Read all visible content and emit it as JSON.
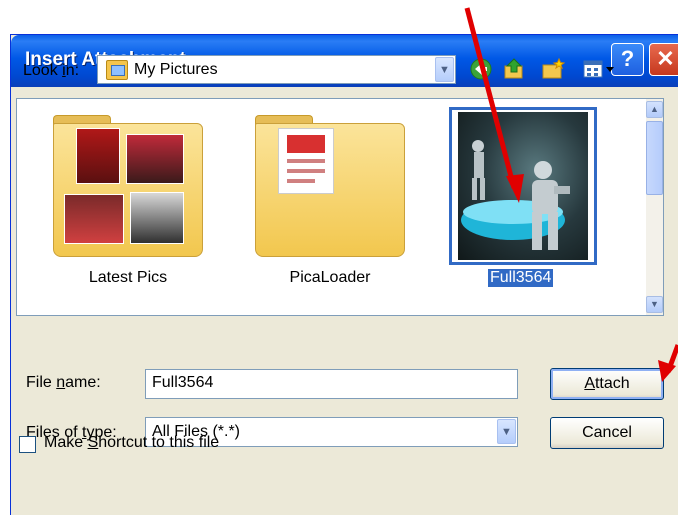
{
  "dialog": {
    "title": "Insert Attachment",
    "help_glyph": "?",
    "close_glyph": "✕"
  },
  "lookin": {
    "label_pre": "Look ",
    "label_accel": "i",
    "label_post": "n:",
    "value": "My Pictures"
  },
  "toolbar": {
    "icons": [
      "back-icon",
      "up-folder-icon",
      "new-folder-icon",
      "views-menu-icon"
    ]
  },
  "files": [
    {
      "name": "Latest Pics",
      "type": "folder"
    },
    {
      "name": "PicaLoader",
      "type": "folder"
    },
    {
      "name": "Full3564",
      "type": "image",
      "selected": true
    }
  ],
  "filename": {
    "label_pre": "File ",
    "label_accel": "n",
    "label_post": "ame:",
    "value": "Full3564"
  },
  "filetype": {
    "label_pre": "Files of ",
    "label_accel": "t",
    "label_post": "ype:",
    "value": "All Files (*.*)"
  },
  "buttons": {
    "attach_accel": "A",
    "attach_rest": "ttach",
    "cancel": "Cancel"
  },
  "shortcut": {
    "label_pre": "Make ",
    "label_accel": "S",
    "label_post": "hortcut to this file",
    "checked": false
  },
  "colors": {
    "titlebar": "#0058e6",
    "selection": "#316ac5",
    "annotation_arrow": "#ff0000",
    "dialog_face": "#ece9d8"
  }
}
